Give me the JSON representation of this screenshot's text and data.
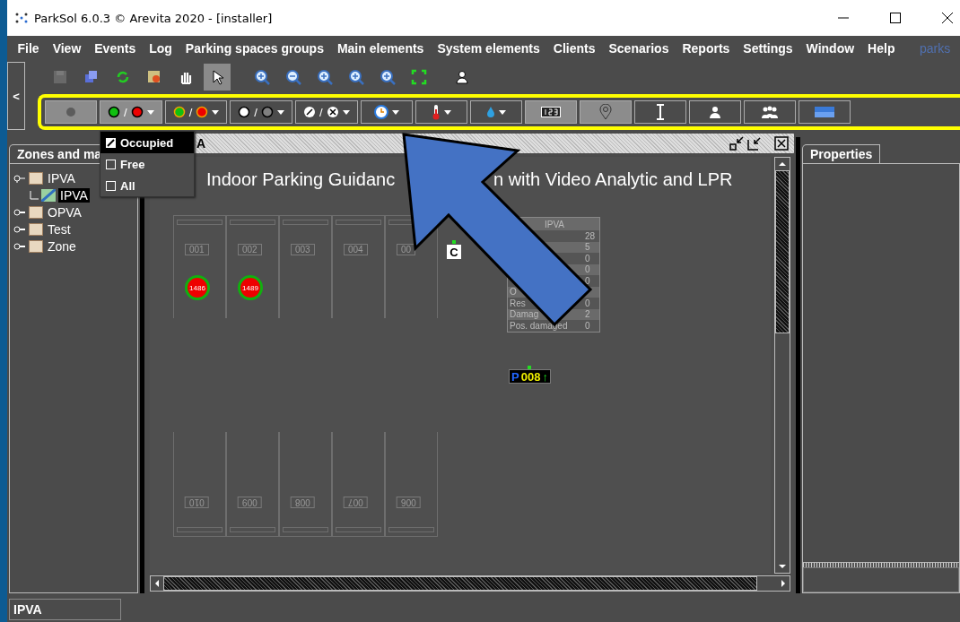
{
  "window": {
    "title": "ParkSol 6.0.3 © Arevita 2020 - [installer]"
  },
  "menu": [
    "File",
    "View",
    "Events",
    "Log",
    "Parking spaces groups",
    "Main elements",
    "System elements",
    "Clients",
    "Scenarios",
    "Reports",
    "Settings",
    "Window",
    "Help"
  ],
  "logo": {
    "text": "parks"
  },
  "collapse_button": "<",
  "toolbar": [
    {
      "kind": "save",
      "selected": false,
      "disabled": true
    },
    {
      "kind": "cubes",
      "selected": false,
      "disabled": false
    },
    {
      "kind": "refresh",
      "selected": false,
      "disabled": false
    },
    {
      "kind": "map",
      "selected": false,
      "disabled": false
    },
    {
      "kind": "hand",
      "selected": false,
      "disabled": false
    },
    {
      "kind": "pointer",
      "selected": true,
      "disabled": false
    },
    {
      "kind": "zoom-in",
      "selected": false,
      "disabled": false
    },
    {
      "kind": "zoom-out",
      "selected": false,
      "disabled": false
    },
    {
      "kind": "zoom-one",
      "selected": false,
      "disabled": false
    },
    {
      "kind": "zoom-fit",
      "selected": false,
      "disabled": false
    },
    {
      "kind": "zoom-screen",
      "selected": false,
      "disabled": false
    },
    {
      "kind": "fullscreen",
      "selected": false,
      "disabled": false
    },
    {
      "kind": "users",
      "selected": false,
      "disabled": false
    }
  ],
  "filter_bar": [
    {
      "kind": "dot",
      "pressed": true,
      "dropdown": false
    },
    {
      "kind": "occupancy",
      "separator": "/",
      "pressed": true,
      "dropdown": true
    },
    {
      "kind": "occupancy-ring",
      "separator": "/",
      "pressed": false,
      "dropdown": true
    },
    {
      "kind": "light",
      "separator": "/",
      "pressed": false,
      "dropdown": true
    },
    {
      "kind": "slash-cross",
      "separator": "/",
      "pressed": false,
      "dropdown": true
    },
    {
      "kind": "clock",
      "pressed": false,
      "dropdown": true
    },
    {
      "kind": "thermometer",
      "pressed": false,
      "dropdown": true
    },
    {
      "kind": "drop",
      "pressed": false,
      "dropdown": true
    },
    {
      "kind": "counter",
      "pressed": true,
      "dropdown": false
    },
    {
      "kind": "pin",
      "pressed": true,
      "dropdown": false
    },
    {
      "kind": "height",
      "pressed": false,
      "dropdown": false
    },
    {
      "kind": "person",
      "pressed": false,
      "dropdown": false
    },
    {
      "kind": "group",
      "pressed": false,
      "dropdown": false
    },
    {
      "kind": "panel",
      "pressed": false,
      "dropdown": false
    }
  ],
  "dropdown_menu": [
    {
      "label": "Occupied",
      "checked": true,
      "selected": true
    },
    {
      "label": "Free",
      "checked": false,
      "selected": false
    },
    {
      "label": "All",
      "checked": false,
      "selected": false
    }
  ],
  "zones_panel": {
    "tab": "Zones and ma",
    "tree": [
      {
        "label": "IPVA",
        "kind": "zone",
        "expanded": true,
        "selected": false,
        "children": [
          {
            "label": "IPVA",
            "kind": "map",
            "selected": true
          }
        ]
      },
      {
        "label": "OPVA",
        "kind": "zone",
        "expanded": false,
        "selected": false
      },
      {
        "label": "Test",
        "kind": "zone",
        "expanded": false,
        "selected": false
      },
      {
        "label": "Zone",
        "kind": "zone",
        "expanded": false,
        "selected": false
      }
    ]
  },
  "map_window": {
    "title": "A",
    "heading_parts": [
      "Indoor Parking Guidanc",
      "n with Video Analytic and LPR"
    ],
    "slots_top": [
      {
        "label": "001",
        "sensor": {
          "text": "1486",
          "occupied": true
        }
      },
      {
        "label": "002",
        "sensor": {
          "text": "1489",
          "occupied": true
        }
      },
      {
        "label": "003"
      },
      {
        "label": "004"
      },
      {
        "label": "00"
      }
    ],
    "slots_bottom": [
      {
        "label": "010"
      },
      {
        "label": "009"
      },
      {
        "label": "008"
      },
      {
        "label": "007"
      },
      {
        "label": "006"
      }
    ],
    "controller": {
      "label": "C",
      "online": true
    },
    "stats": {
      "title": "IPVA",
      "rows": [
        {
          "value": "28"
        },
        {
          "value": "5"
        },
        {
          "value": "0"
        },
        {
          "value": "0"
        },
        {
          "value": "0"
        },
        {
          "label": "O"
        },
        {
          "label": "Res",
          "value": "0"
        },
        {
          "label": "Damag",
          "value": "2"
        },
        {
          "label": "Pos. damaged",
          "value": "0"
        }
      ]
    },
    "display": {
      "prefix": "P",
      "count": "008",
      "arrow": "↑",
      "online": true
    }
  },
  "properties_panel": {
    "tab": "Properties"
  },
  "status_bar": {
    "text": "IPVA"
  }
}
